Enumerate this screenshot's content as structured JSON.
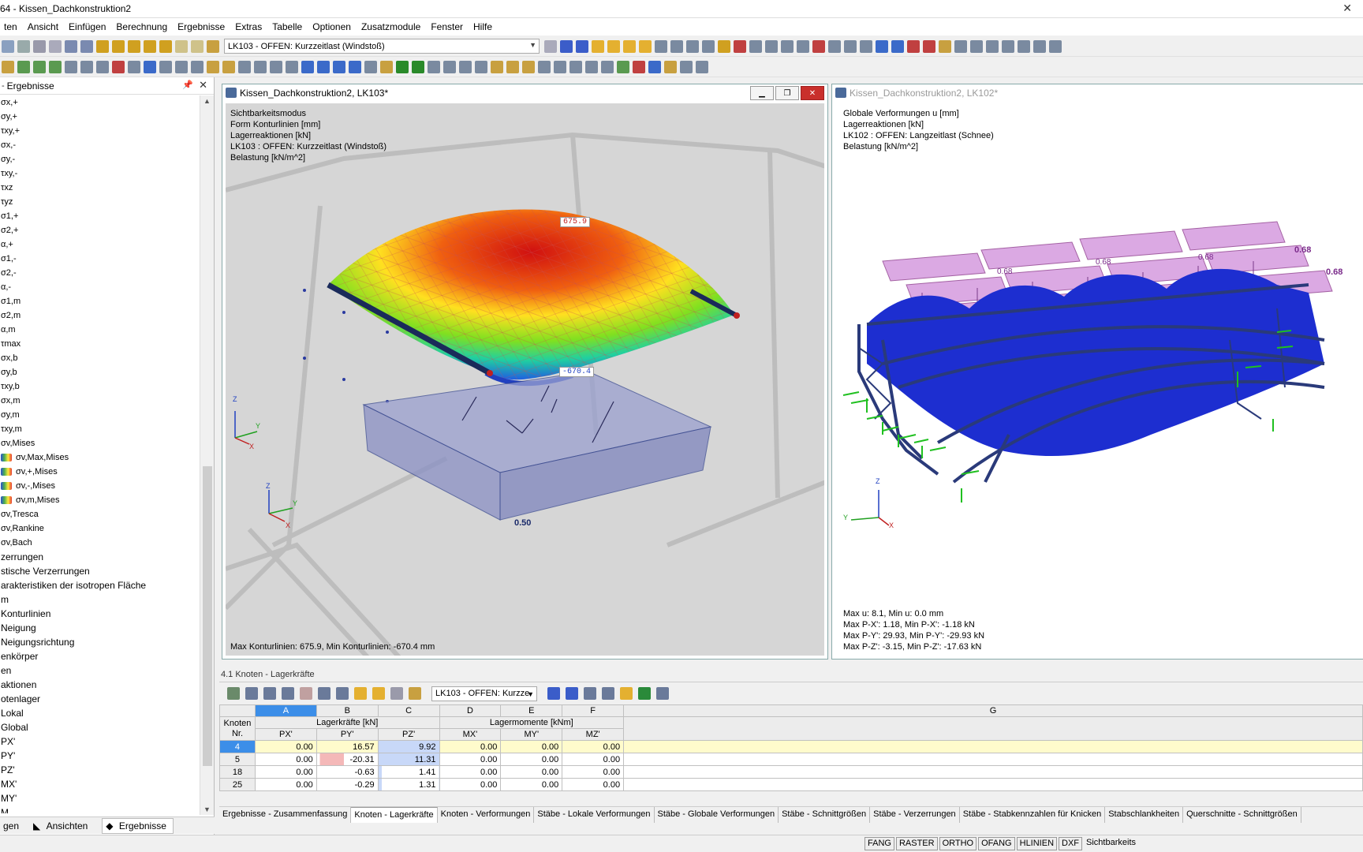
{
  "titlebar": {
    "title": "64 - Kissen_Dachkonstruktion2"
  },
  "menu": [
    "ten",
    "Ansicht",
    "Einfügen",
    "Berechnung",
    "Ergebnisse",
    "Extras",
    "Tabelle",
    "Optionen",
    "Zusatzmodule",
    "Fenster",
    "Hilfe"
  ],
  "toolbar": {
    "loadcase": "LK103 - OFFEN: Kurzzeitlast (Windstoß)"
  },
  "navigator": {
    "title": "Ergebnisse",
    "items": [
      "σx,+",
      "σy,+",
      "τxy,+",
      "σx,-",
      "σy,-",
      "τxy,-",
      "τxz",
      "τyz",
      "σ1,+",
      "σ2,+",
      "α,+",
      "σ1,-",
      "σ2,-",
      "α,-",
      "σ1,m",
      "σ2,m",
      "α,m",
      "τmax",
      "σx,b",
      "σy,b",
      "τxy,b",
      "σx,m",
      "σy,m",
      "τxy,m",
      "σv,Mises",
      "σv,Max,Mises",
      "σv,+,Mises",
      "σv,-,Mises",
      "σv,m,Mises",
      "σv,Tresca",
      "σv,Rankine",
      "σv,Bach",
      "zerrungen",
      "stische Verzerrungen",
      "arakteristiken der isotropen Fläche",
      "m",
      "Konturlinien",
      "Neigung",
      "Neigungsrichtung",
      "enkörper",
      "en",
      "aktionen",
      "otenlager",
      "Lokal",
      "Global",
      "PX'",
      "PY'",
      "PZ'",
      "MX'",
      "MY'",
      "M"
    ],
    "bottom_tabs": [
      "gen",
      "Ansichten",
      "Ergebnisse"
    ]
  },
  "view1": {
    "title": "Kissen_Dachkonstruktion2, LK103*",
    "info": [
      "Sichtbarkeitsmodus",
      "Form Konturlinien [mm]",
      "Lagerreaktionen [kN]",
      "LK103 : OFFEN: Kurzzeitlast (Windstoß)",
      "Belastung [kN/m^2]"
    ],
    "max_label": "675.9",
    "min_label": "-670.4",
    "load_label": "0.50",
    "footer": "Max Konturlinien: 675.9, Min Konturlinien: -670.4 mm",
    "axis": {
      "z": "Z",
      "y": "Y",
      "x": "X"
    }
  },
  "view2": {
    "title": "Kissen_Dachkonstruktion2, LK102*",
    "info": [
      "Globale Verformungen u [mm]",
      "Lagerreaktionen [kN]",
      "LK102 : OFFEN: Langzeitlast (Schnee)",
      "Belastung [kN/m^2]"
    ],
    "load_value": "0.68",
    "footer": [
      "Max u: 8.1, Min u: 0.0 mm",
      "Max P-X': 1.18, Min P-X': -1.18 kN",
      "Max P-Y': 29.93, Min P-Y': -29.93 kN",
      "Max P-Z': -3.15, Min P-Z': -17.63 kN"
    ],
    "axis": {
      "z": "Z",
      "y": "Y",
      "x": "X"
    }
  },
  "table": {
    "title": "4.1 Knoten - Lagerkräfte",
    "loadcase": "LK103 - OFFEN: Kurzze",
    "col_letters": [
      "A",
      "B",
      "C",
      "D",
      "E",
      "F",
      "G"
    ],
    "knoten_header": [
      "Knoten",
      "Nr."
    ],
    "group_forces": "Lagerkräfte [kN]",
    "group_moments": "Lagermomente [kNm]",
    "sub_headers": [
      "PX'",
      "PY'",
      "PZ'",
      "MX'",
      "MY'",
      "MZ'"
    ],
    "rows": [
      {
        "nr": "4",
        "px": "0.00",
        "py": "16.57",
        "pz": "9.92",
        "mx": "0.00",
        "my": "0.00",
        "mz": "0.00"
      },
      {
        "nr": "5",
        "px": "0.00",
        "py": "-20.31",
        "pz": "11.31",
        "mx": "0.00",
        "my": "0.00",
        "mz": "0.00"
      },
      {
        "nr": "18",
        "px": "0.00",
        "py": "-0.63",
        "pz": "1.41",
        "mx": "0.00",
        "my": "0.00",
        "mz": "0.00"
      },
      {
        "nr": "25",
        "px": "0.00",
        "py": "-0.29",
        "pz": "1.31",
        "mx": "0.00",
        "my": "0.00",
        "mz": "0.00"
      }
    ],
    "tabs": [
      "Ergebnisse - Zusammenfassung",
      "Knoten - Lagerkräfte",
      "Knoten - Verformungen",
      "Stäbe - Lokale Verformungen",
      "Stäbe - Globale Verformungen",
      "Stäbe - Schnittgrößen",
      "Stäbe - Verzerrungen",
      "Stäbe - Stabkennzahlen für Knicken",
      "Stabschlankheiten",
      "Querschnitte - Schnittgrößen"
    ]
  },
  "statusbar": [
    "FANG",
    "RASTER",
    "ORTHO",
    "OFANG",
    "HLINIEN",
    "DXF",
    "Sichtbarkeits"
  ]
}
